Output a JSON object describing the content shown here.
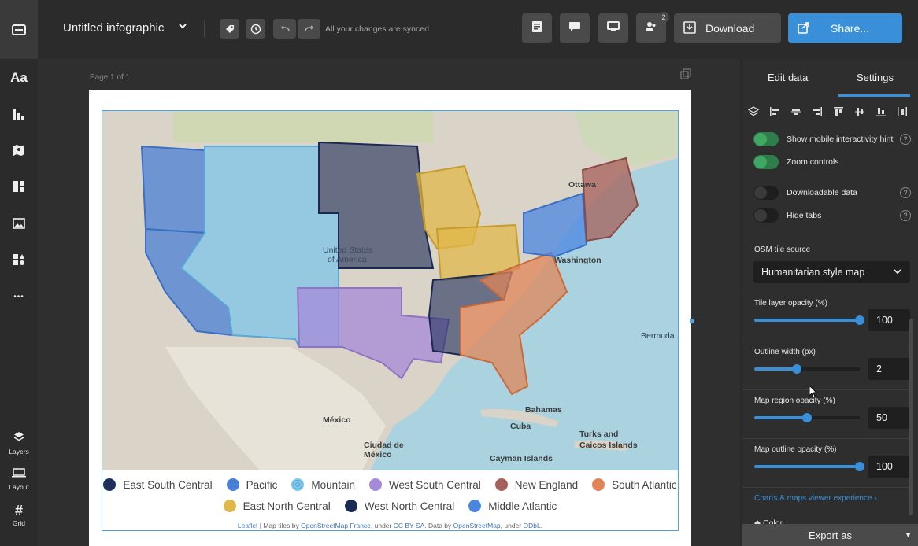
{
  "app": {
    "title": "Untitled infographic",
    "sync_status": "All your changes are synced",
    "collaborator_count": "2",
    "download_label": "Download",
    "share_label": "Share..."
  },
  "left_rail": {
    "items": [
      {
        "name": "text-icon",
        "glyph": "Aa"
      },
      {
        "name": "chart-icon"
      },
      {
        "name": "map-icon"
      },
      {
        "name": "widgets-icon"
      },
      {
        "name": "image-icon"
      },
      {
        "name": "shapes-icon"
      },
      {
        "name": "more-icon",
        "glyph": "•••"
      }
    ],
    "layers_label": "Layers",
    "layout_label": "Layout",
    "grid_label": "Grid"
  },
  "canvas": {
    "page_label": "Page 1 of 1"
  },
  "map": {
    "labels": {
      "country_line1": "United States",
      "country_line2": "of America",
      "ottawa": "Ottawa",
      "washington": "Washington",
      "bermuda": "Bermuda",
      "bahamas": "Bahamas",
      "cuba": "Cuba",
      "mexico": "México",
      "mexico_city_line1": "Ciudad de",
      "mexico_city_line2": "México",
      "turks_line1": "Turks and",
      "turks_line2": "Caicos Islands",
      "cayman": "Cayman Islands"
    },
    "legend": [
      {
        "label": "East South Central",
        "color": "#1f2f5c"
      },
      {
        "label": "Pacific",
        "color": "#4a7fd6"
      },
      {
        "label": "Mountain",
        "color": "#7ec6ea"
      },
      {
        "label": "West South Central",
        "color": "#a58ad8"
      },
      {
        "label": "New England",
        "color": "#a5605a"
      },
      {
        "label": "South Atlantic",
        "color": "#e0855a"
      },
      {
        "label": "East North Central",
        "color": "#e0b84a"
      },
      {
        "label": "West North Central",
        "color": "#1a2a55"
      },
      {
        "label": "Middle Atlantic",
        "color": "#4a85e0"
      }
    ],
    "attribution": {
      "leaflet": "Leaflet",
      "text1": " | Map tiles by ",
      "osm_france": "OpenStreetMap France",
      "text2": ", under ",
      "cc": "CC BY SA",
      "text3": ". Data by ",
      "osm": "OpenStreetMap",
      "text4": ", under ",
      "odbl": "ODbL",
      "text5": "."
    }
  },
  "panel": {
    "tab_edit": "Edit data",
    "tab_settings": "Settings",
    "options": [
      {
        "label": "Show mobile interactivity hint",
        "on": true
      },
      {
        "label": "Zoom controls",
        "on": true
      },
      {
        "label": "Downloadable data",
        "on": false
      },
      {
        "label": "Hide tabs",
        "on": false
      }
    ],
    "osm_label": "OSM tile source",
    "osm_value": "Humanitarian style map",
    "sliders": [
      {
        "label": "Tile layer opacity (%)",
        "value": "100",
        "fraction": 1.0
      },
      {
        "label": "Outline width (px)",
        "value": "2",
        "fraction": 0.4
      },
      {
        "label": "Map region opacity (%)",
        "value": "50",
        "fraction": 0.5
      },
      {
        "label": "Map outline opacity (%)",
        "value": "100",
        "fraction": 1.0
      }
    ],
    "viewer_link": "Charts & maps viewer experience",
    "color_label": "Color",
    "export_label": "Export as"
  }
}
